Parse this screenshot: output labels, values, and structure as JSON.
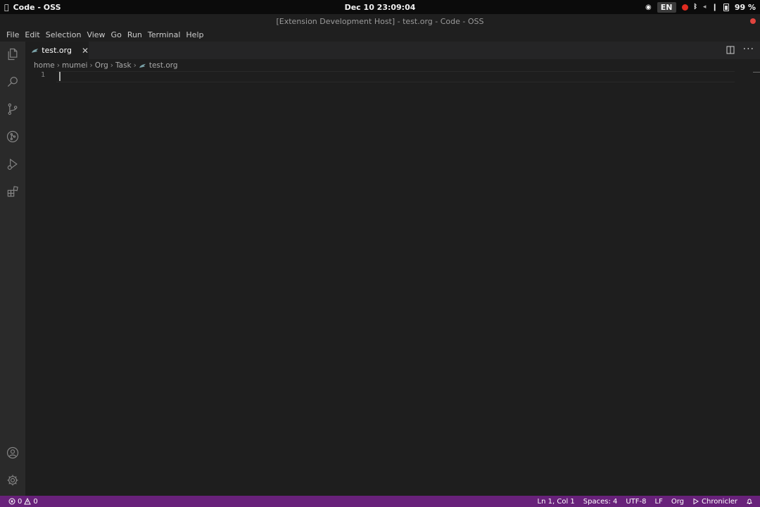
{
  "system_bar": {
    "app_name": "Code - OSS",
    "datetime": "Dec 10  23:09:04",
    "input_source": "EN",
    "battery": "99 %"
  },
  "window": {
    "title": "[Extension Development Host] - test.org - Code - OSS"
  },
  "menu": [
    "File",
    "Edit",
    "Selection",
    "View",
    "Go",
    "Run",
    "Terminal",
    "Help"
  ],
  "activity_bar": {
    "top_icons": [
      "explorer-icon",
      "search-icon",
      "source-control-icon",
      "git-graph-icon",
      "run-debug-icon",
      "extensions-icon"
    ],
    "bottom_icons": [
      "accounts-icon",
      "settings-gear-icon"
    ]
  },
  "tabs": [
    {
      "label": "test.org",
      "active": true,
      "icon": "org-unicorn-icon"
    }
  ],
  "breadcrumb": [
    "home",
    "mumei",
    "Org",
    "Task",
    "test.org"
  ],
  "editor": {
    "line_numbers": [
      "1"
    ],
    "content": ""
  },
  "status_bar": {
    "errors": "0",
    "warnings": "0",
    "position": "Ln 1, Col 1",
    "indentation": "Spaces: 4",
    "encoding": "UTF-8",
    "eol": "LF",
    "language": "Org",
    "extension": "Chronicler",
    "accent_color": "#68217a"
  }
}
